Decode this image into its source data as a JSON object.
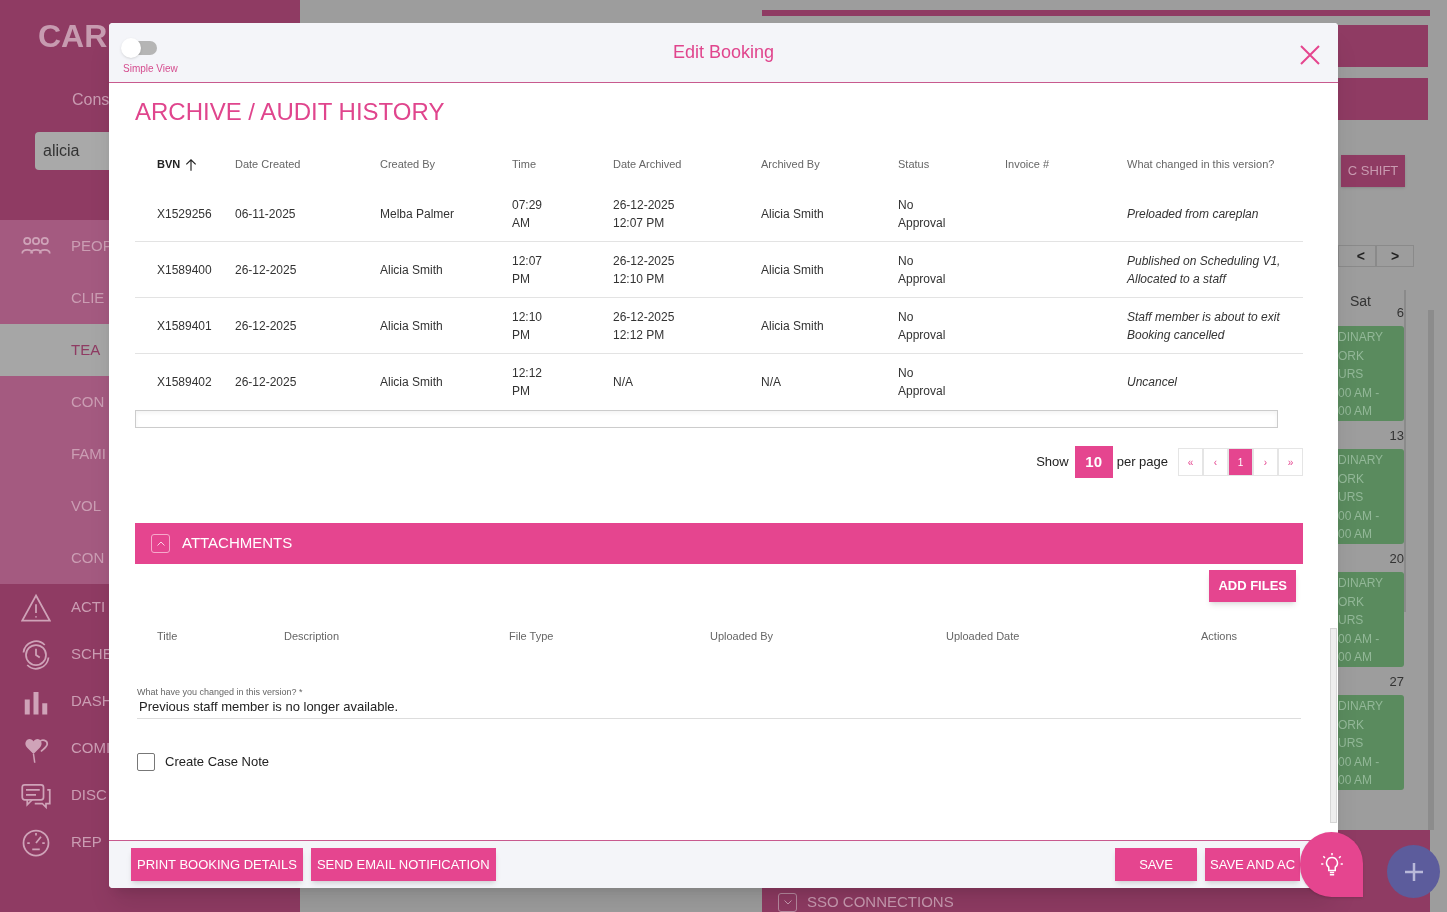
{
  "background": {
    "logo": "CAR",
    "subtitle": "Cons",
    "search": {
      "value": "alicia"
    },
    "nav": [
      {
        "label": "PEOP",
        "kind": "section",
        "selected": false
      },
      {
        "label": "CLIE",
        "kind": "sub",
        "selected": false
      },
      {
        "label": "TEA",
        "kind": "sub",
        "selected": true
      },
      {
        "label": "CON",
        "kind": "sub",
        "selected": false
      },
      {
        "label": "FAMI",
        "kind": "sub",
        "selected": false
      },
      {
        "label": "VOL",
        "kind": "sub",
        "selected": false
      },
      {
        "label": "CON",
        "kind": "sub",
        "selected": false
      },
      {
        "label": "ACTI",
        "kind": "item",
        "selected": false
      },
      {
        "label": "SCHE",
        "kind": "item",
        "selected": false
      },
      {
        "label": "DASH",
        "kind": "item",
        "selected": false
      },
      {
        "label": "COMI",
        "kind": "item",
        "selected": false
      },
      {
        "label": "DISC",
        "kind": "item",
        "selected": false
      },
      {
        "label": "REP",
        "kind": "item",
        "selected": false
      }
    ],
    "shift_button": "C SHIFT",
    "prev": "<",
    "next": ">",
    "day": "Sat",
    "weeks": [
      {
        "date": "6",
        "lines": [
          "DINARY",
          "ORK",
          "URS",
          "00 AM -",
          "00 AM"
        ]
      },
      {
        "date": "13",
        "lines": [
          "DINARY",
          "ORK",
          "URS",
          "00 AM -",
          "00 AM"
        ]
      },
      {
        "date": "20",
        "lines": [
          "DINARY",
          "ORK",
          "URS",
          "00 AM -",
          "00 AM"
        ]
      },
      {
        "date": "27",
        "lines": [
          "DINARY",
          "ORK",
          "URS",
          "00 AM -",
          "00 AM"
        ]
      }
    ],
    "sso": {
      "title": "SSO CONNECTIONS",
      "expanded": false
    }
  },
  "modal": {
    "title": "Edit Booking",
    "simple_view": {
      "label": "Simple View",
      "on": false
    },
    "section_title": "ARCHIVE / AUDIT HISTORY",
    "columns": [
      "BVN",
      "Date Created",
      "Created By",
      "Time",
      "Date Archived",
      "Archived By",
      "Status",
      "Invoice #",
      "What changed in this version?"
    ],
    "rows": [
      {
        "bvn": "X1529256",
        "date_created": "06-11-2025",
        "created_by": "Melba Palmer",
        "time": "07:29 AM",
        "date_archived": "26-12-2025 12:07 PM",
        "archived_by": "Alicia Smith",
        "status": "No Approval",
        "change": "Preloaded from careplan"
      },
      {
        "bvn": "X1589400",
        "date_created": "26-12-2025",
        "created_by": "Alicia Smith",
        "time": "12:07 PM",
        "date_archived": "26-12-2025 12:10 PM",
        "archived_by": "Alicia Smith",
        "status": "No Approval",
        "change": "Published on Scheduling V1, Allocated to a staff"
      },
      {
        "bvn": "X1589401",
        "date_created": "26-12-2025",
        "created_by": "Alicia Smith",
        "time": "12:10 PM",
        "date_archived": "26-12-2025 12:12 PM",
        "archived_by": "Alicia Smith",
        "status": "No Approval",
        "change": "Staff member is about to exit Booking cancelled"
      },
      {
        "bvn": "X1589402",
        "date_created": "26-12-2025",
        "created_by": "Alicia Smith",
        "time": "12:12 PM",
        "date_archived": "N/A",
        "archived_by": "N/A",
        "status": "No Approval",
        "change": "Uncancel"
      }
    ],
    "pagination": {
      "show": "Show",
      "page_size": "10",
      "per_page": "per page",
      "pages": [
        {
          "label": "«",
          "selected": false
        },
        {
          "label": "‹",
          "selected": false
        },
        {
          "label": "1",
          "selected": true
        },
        {
          "label": "›",
          "selected": false
        },
        {
          "label": "»",
          "selected": false
        }
      ]
    },
    "attachments": {
      "title": "ATTACHMENTS",
      "expanded": true,
      "add_button": "ADD FILES",
      "columns": [
        "Title",
        "Description",
        "File Type",
        "Uploaded By",
        "Uploaded Date",
        "Actions"
      ]
    },
    "change_field": {
      "label": "What have you changed in this version? *",
      "value": "Previous staff member is no longer available."
    },
    "case_note": {
      "label": "Create Case Note",
      "checked": false
    },
    "footer_left": [
      "PRINT BOOKING DETAILS",
      "SEND EMAIL NOTIFICATION"
    ],
    "footer_right": [
      "SAVE",
      "SAVE AND AC"
    ]
  }
}
